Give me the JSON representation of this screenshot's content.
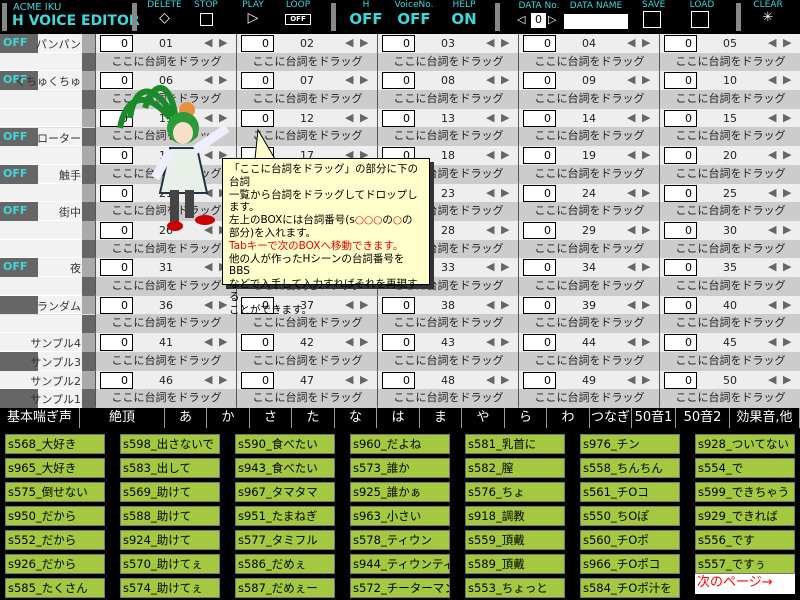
{
  "app": {
    "brand": "ACME IKU",
    "title": "H VOICE EDITOR"
  },
  "toolbar": {
    "delete": "DELETE",
    "stop": "STOP",
    "play": "PLAY",
    "loop": "LOOP",
    "loop_state": "OFF",
    "h": "H",
    "h_state": "OFF",
    "voice_no": "VoiceNo.",
    "voice_no_state": "OFF",
    "help": "HELP",
    "help_state": "ON",
    "data_no": "DATA No.",
    "data_no_value": "0",
    "data_name": "DATA NAME",
    "data_name_value": "",
    "save": "SAVE",
    "load": "LOAD",
    "clear": "CLEAR"
  },
  "grid": {
    "slot_value": "0",
    "drag_text": "ここに台詞をドラッグ",
    "slot_count": 50,
    "rows": [
      {
        "off": true,
        "label": "パンパン"
      },
      {},
      {
        "off": true,
        "label": "くちゅくちゅ"
      },
      {},
      {},
      {
        "off": true,
        "label": "ローター"
      },
      {},
      {
        "off": true,
        "label": "触手"
      },
      {},
      {
        "off": true,
        "label": "街中"
      },
      {},
      {},
      {
        "off": true,
        "label": "夜"
      },
      {},
      {
        "dark": true,
        "label": "ランダム"
      },
      {},
      {
        "label": "サンプル4"
      },
      {
        "dark": true,
        "label": "サンプル3"
      },
      {
        "label": "サンプル2"
      },
      {
        "dark": true,
        "label": "サンプル1"
      }
    ],
    "off_label": "OFF"
  },
  "tooltip": {
    "lines": [
      "「ここに台詞をドラッグ」の部分に下の台詞",
      "一覧から台詞をドラッグしてドロップします。"
    ],
    "line3a": "左上のBOXには台詞番号(s",
    "line3b": "○○○",
    "line3c": "の",
    "line3d": "○",
    "line3e": "の",
    "line4": "部分)を入れます。",
    "line5": "Tabキーで次のBOXへ移動できます。",
    "line6": "他の人が作ったHシーンの台詞番号をBBS",
    "line7": "などで入手して入力すればそれを再現する",
    "line8": "ことができます。"
  },
  "categories": [
    "基本喘ぎ声",
    "絶頂",
    "あ",
    "か",
    "さ",
    "た",
    "な",
    "は",
    "ま",
    "や",
    "ら",
    "わ",
    "つなぎ",
    "50音1",
    "50音2",
    "効果音,他"
  ],
  "phrases": [
    [
      "s568_大好き",
      "s965_大好き",
      "s575_倒せない",
      "s950_だから",
      "s552_だから",
      "s926_だから",
      "s585_たくさん"
    ],
    [
      "s598_出さないで",
      "s583_出して",
      "s569_助けて",
      "s588_助けて",
      "s924_助けて",
      "s570_助けてぇ",
      "s574_助けてぇ"
    ],
    [
      "s590_食べたい",
      "s943_食べたい",
      "s967_タマタマ",
      "s951_たまねぎ",
      "s577_タミフル",
      "s586_だめぇ",
      "s587_だめぇー"
    ],
    [
      "s960_だよね",
      "s573_誰か",
      "s925_誰かぁ",
      "s963_小さい",
      "s578_ティウン",
      "s944_ティウンティウン",
      "s572_チーターマン"
    ],
    [
      "s581_乳首に",
      "s582_膣",
      "s576_ちょ",
      "s918_調教",
      "s559_頂戴",
      "s589_頂戴",
      "s553_ちょっと"
    ],
    [
      "s976_チン",
      "s558_ちんちん",
      "s561_チOコ",
      "s550_ちOぽ",
      "s560_チOポ",
      "s966_チOポコ",
      "s584_チOポ汁を"
    ],
    [
      "s928_ついてない",
      "s554_で",
      "s599_できちゃう",
      "s929_できれば",
      "s556_です",
      "s557_ですぅ"
    ]
  ],
  "next_page": "次のページ→",
  "colors": {
    "accent": "#3fd8d8",
    "phrase": "#a4c840",
    "tooltip": "#ffffcc"
  }
}
